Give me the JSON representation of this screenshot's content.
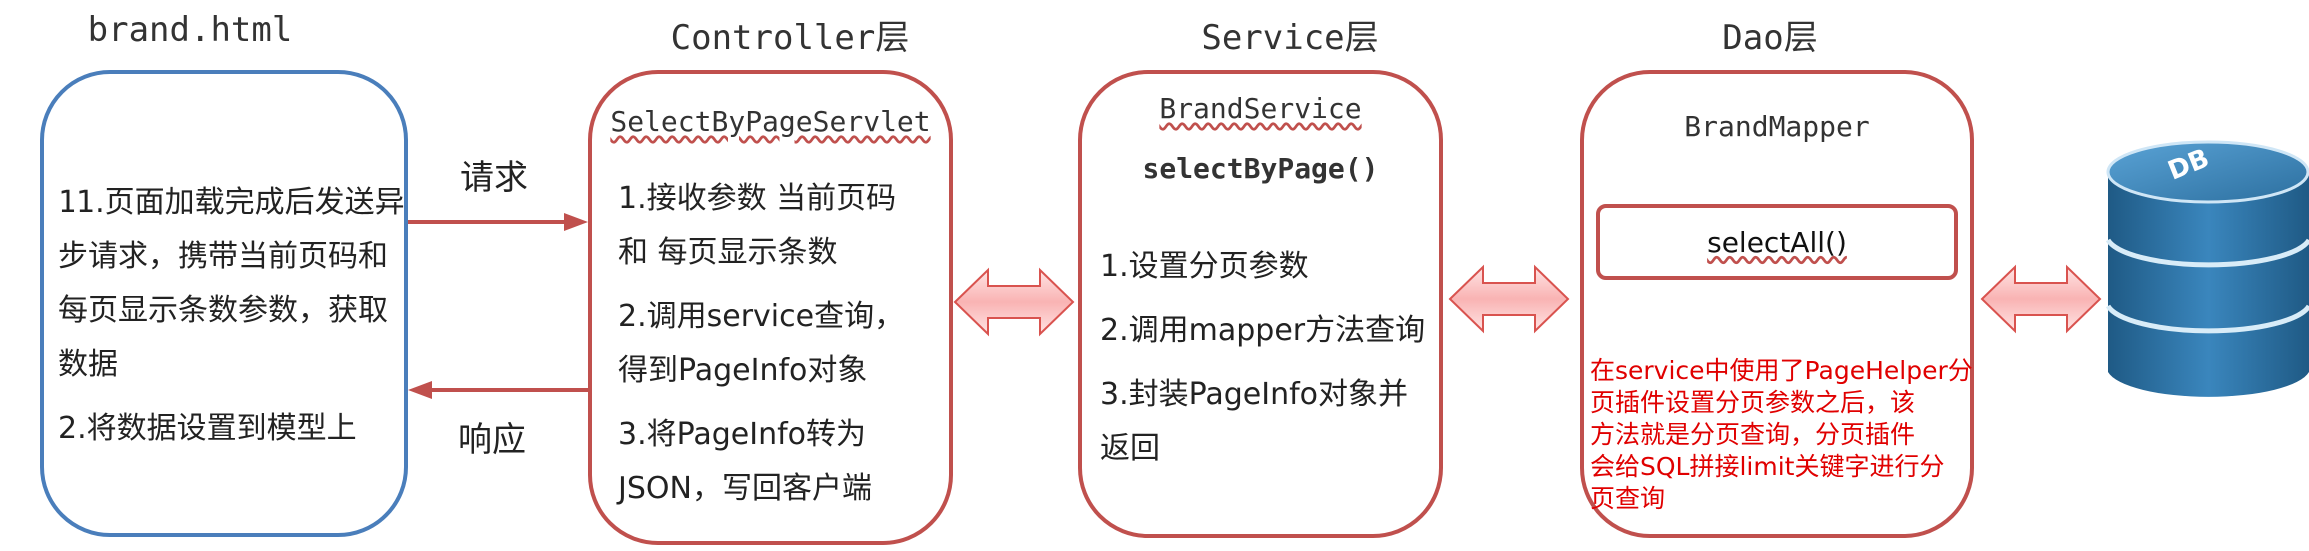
{
  "columns": {
    "view": "brand.html",
    "controller": "Controller层",
    "service": "Service层",
    "dao": "Dao层"
  },
  "view_box": {
    "lines": [
      "1.页面加载完成后发送异",
      "步请求，携带当前页码和",
      "每页显示条数参数，获取",
      "数据",
      "2.将数据设置到模型上"
    ]
  },
  "controller_box": {
    "title": "SelectByPageServlet",
    "lines": [
      "1.接收参数 当前页码",
      "和 每页显示条数",
      "2.调用service查询，",
      "得到PageInfo对象",
      "3.将PageInfo转为",
      "JSON，写回客户端"
    ]
  },
  "service_box": {
    "title": "BrandService",
    "method": "selectByPage()",
    "lines": [
      "1.设置分页参数",
      "2.调用mapper方法查询",
      "3.封装PageInfo对象并",
      "返回"
    ]
  },
  "dao_box": {
    "title": "BrandMapper",
    "method": "selectAll()",
    "note": [
      "在service中使用了PageHelper分",
      "页插件设置分页参数之后，该",
      "方法就是分页查询，分页插件",
      "会给SQL拼接limit关键字进行分",
      "页查询"
    ]
  },
  "arrows": {
    "request": "请求",
    "response": "响应"
  },
  "db": {
    "label": "DB"
  },
  "colors": {
    "blue_border": "#4a7ebb",
    "red_border": "#c0504d",
    "note_text": "#e00000",
    "db_blue": "#2e6e9e"
  }
}
